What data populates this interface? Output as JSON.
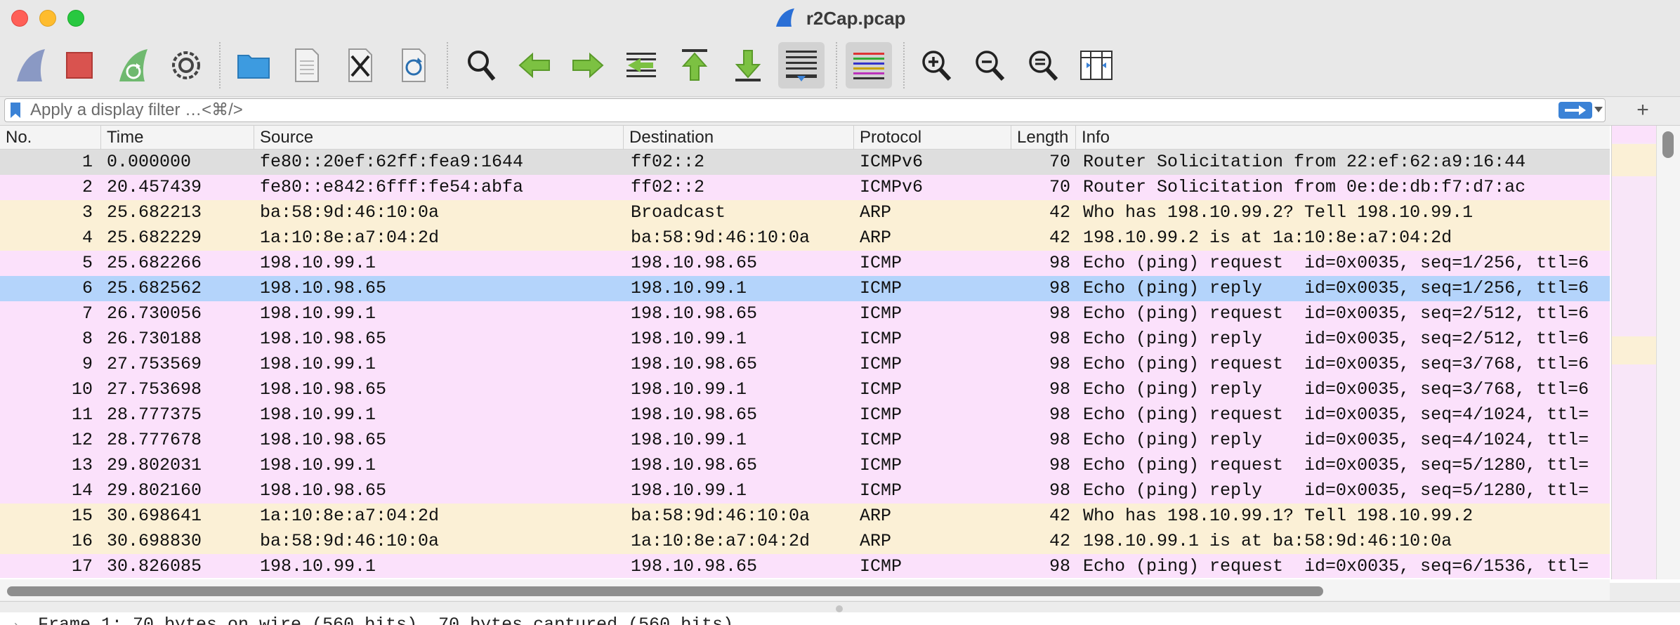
{
  "window": {
    "title": "r2Cap.pcap"
  },
  "toolbar": {
    "buttons": [
      {
        "name": "start-capture-icon"
      },
      {
        "name": "stop-capture-icon"
      },
      {
        "name": "restart-capture-icon"
      },
      {
        "name": "capture-options-icon"
      },
      {
        "name": "open-file-icon"
      },
      {
        "name": "save-file-icon"
      },
      {
        "name": "close-file-icon"
      },
      {
        "name": "reload-file-icon"
      },
      {
        "name": "find-packet-icon"
      },
      {
        "name": "go-back-icon"
      },
      {
        "name": "go-forward-icon"
      },
      {
        "name": "go-to-packet-icon"
      },
      {
        "name": "first-packet-icon"
      },
      {
        "name": "last-packet-icon"
      },
      {
        "name": "autoscroll-icon"
      },
      {
        "name": "colorize-icon"
      },
      {
        "name": "zoom-in-icon"
      },
      {
        "name": "zoom-out-icon"
      },
      {
        "name": "normal-size-icon"
      },
      {
        "name": "resize-columns-icon"
      }
    ]
  },
  "filter": {
    "placeholder": "Apply a display filter …<⌘/>",
    "value": "",
    "add_label": "+"
  },
  "packet_list": {
    "columns": [
      "No.",
      "Time",
      "Source",
      "Destination",
      "Protocol",
      "Length",
      "Info"
    ],
    "selected_row": 6,
    "colors": {
      "icmp": "#fbe1fb",
      "arp": "#fbf0d6",
      "icmpv6": "#dedede",
      "selected": "#b4d4fb"
    },
    "rows": [
      {
        "no": "1",
        "time": "0.000000",
        "source": "fe80::20ef:62ff:fea9:1644",
        "destination": "ff02::2",
        "protocol": "ICMPv6",
        "length": "70",
        "info": "Router Solicitation from 22:ef:62:a9:16:44",
        "color": "icmpv6"
      },
      {
        "no": "2",
        "time": "20.457439",
        "source": "fe80::e842:6fff:fe54:abfa",
        "destination": "ff02::2",
        "protocol": "ICMPv6",
        "length": "70",
        "info": "Router Solicitation from 0e:de:db:f7:d7:ac",
        "color": "icmp"
      },
      {
        "no": "3",
        "time": "25.682213",
        "source": "ba:58:9d:46:10:0a",
        "destination": "Broadcast",
        "protocol": "ARP",
        "length": "42",
        "info": "Who has 198.10.99.2? Tell 198.10.99.1",
        "color": "arp"
      },
      {
        "no": "4",
        "time": "25.682229",
        "source": "1a:10:8e:a7:04:2d",
        "destination": "ba:58:9d:46:10:0a",
        "protocol": "ARP",
        "length": "42",
        "info": "198.10.99.2 is at 1a:10:8e:a7:04:2d",
        "color": "arp"
      },
      {
        "no": "5",
        "time": "25.682266",
        "source": "198.10.99.1",
        "destination": "198.10.98.65",
        "protocol": "ICMP",
        "length": "98",
        "info": "Echo (ping) request  id=0x0035, seq=1/256, ttl=6",
        "color": "icmp"
      },
      {
        "no": "6",
        "time": "25.682562",
        "source": "198.10.98.65",
        "destination": "198.10.99.1",
        "protocol": "ICMP",
        "length": "98",
        "info": "Echo (ping) reply    id=0x0035, seq=1/256, ttl=6",
        "color": "selected"
      },
      {
        "no": "7",
        "time": "26.730056",
        "source": "198.10.99.1",
        "destination": "198.10.98.65",
        "protocol": "ICMP",
        "length": "98",
        "info": "Echo (ping) request  id=0x0035, seq=2/512, ttl=6",
        "color": "icmp"
      },
      {
        "no": "8",
        "time": "26.730188",
        "source": "198.10.98.65",
        "destination": "198.10.99.1",
        "protocol": "ICMP",
        "length": "98",
        "info": "Echo (ping) reply    id=0x0035, seq=2/512, ttl=6",
        "color": "icmp"
      },
      {
        "no": "9",
        "time": "27.753569",
        "source": "198.10.99.1",
        "destination": "198.10.98.65",
        "protocol": "ICMP",
        "length": "98",
        "info": "Echo (ping) request  id=0x0035, seq=3/768, ttl=6",
        "color": "icmp"
      },
      {
        "no": "10",
        "time": "27.753698",
        "source": "198.10.98.65",
        "destination": "198.10.99.1",
        "protocol": "ICMP",
        "length": "98",
        "info": "Echo (ping) reply    id=0x0035, seq=3/768, ttl=6",
        "color": "icmp"
      },
      {
        "no": "11",
        "time": "28.777375",
        "source": "198.10.99.1",
        "destination": "198.10.98.65",
        "protocol": "ICMP",
        "length": "98",
        "info": "Echo (ping) request  id=0x0035, seq=4/1024, ttl=",
        "color": "icmp"
      },
      {
        "no": "12",
        "time": "28.777678",
        "source": "198.10.98.65",
        "destination": "198.10.99.1",
        "protocol": "ICMP",
        "length": "98",
        "info": "Echo (ping) reply    id=0x0035, seq=4/1024, ttl=",
        "color": "icmp"
      },
      {
        "no": "13",
        "time": "29.802031",
        "source": "198.10.99.1",
        "destination": "198.10.98.65",
        "protocol": "ICMP",
        "length": "98",
        "info": "Echo (ping) request  id=0x0035, seq=5/1280, ttl=",
        "color": "icmp"
      },
      {
        "no": "14",
        "time": "29.802160",
        "source": "198.10.98.65",
        "destination": "198.10.99.1",
        "protocol": "ICMP",
        "length": "98",
        "info": "Echo (ping) reply    id=0x0035, seq=5/1280, ttl=",
        "color": "icmp"
      },
      {
        "no": "15",
        "time": "30.698641",
        "source": "1a:10:8e:a7:04:2d",
        "destination": "ba:58:9d:46:10:0a",
        "protocol": "ARP",
        "length": "42",
        "info": "Who has 198.10.99.1? Tell 198.10.99.2",
        "color": "arp"
      },
      {
        "no": "16",
        "time": "30.698830",
        "source": "ba:58:9d:46:10:0a",
        "destination": "1a:10:8e:a7:04:2d",
        "protocol": "ARP",
        "length": "42",
        "info": "198.10.99.1 is at ba:58:9d:46:10:0a",
        "color": "arp"
      },
      {
        "no": "17",
        "time": "30.826085",
        "source": "198.10.99.1",
        "destination": "198.10.98.65",
        "protocol": "ICMP",
        "length": "98",
        "info": "Echo (ping) request  id=0x0035, seq=6/1536, ttl=",
        "color": "icmp"
      }
    ]
  },
  "detail": {
    "first_line": "Frame 1: 70 bytes on wire (560 bits), 70 bytes captured (560 bits)"
  }
}
